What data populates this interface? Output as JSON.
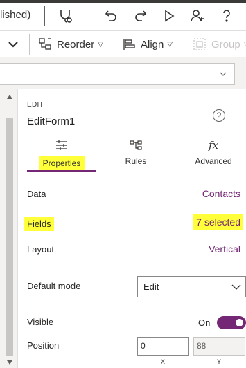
{
  "topbar": {
    "status_text": "lished)"
  },
  "ribbon": {
    "reorder_label": "Reorder",
    "align_label": "Align",
    "group_label": "Group"
  },
  "panel": {
    "caption": "EDIT",
    "form_name": "EditForm1",
    "help_label": "?",
    "tabs": [
      {
        "label": "Properties",
        "icon": "sliders-icon",
        "active": true
      },
      {
        "label": "Rules",
        "icon": "rules-icon",
        "active": false
      },
      {
        "label": "Advanced",
        "icon": "fx-icon",
        "active": false
      }
    ],
    "properties": {
      "data": {
        "label": "Data",
        "value": "Contacts"
      },
      "fields": {
        "label": "Fields",
        "value": "7 selected"
      },
      "layout": {
        "label": "Layout",
        "value": "Vertical"
      },
      "default_mode": {
        "label": "Default mode",
        "value": "Edit"
      },
      "visible": {
        "label": "Visible",
        "state_label": "On",
        "on": true
      },
      "position": {
        "label": "Position",
        "x": "0",
        "y": "88",
        "x_label": "X",
        "y_label": "Y"
      }
    }
  },
  "colors": {
    "accent": "#742774",
    "highlight": "#ffff3a"
  }
}
